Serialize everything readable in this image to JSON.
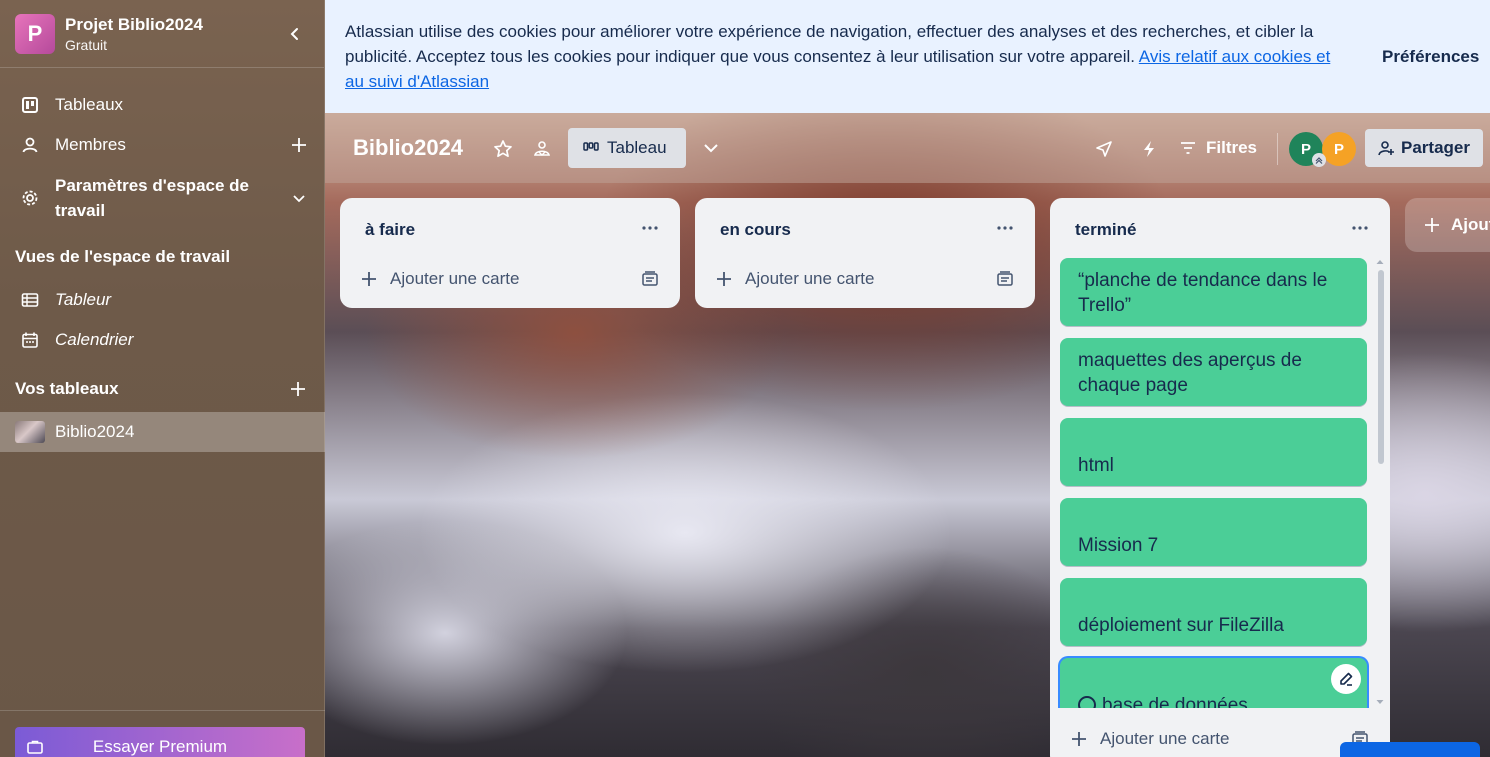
{
  "workspace": {
    "logo_letter": "P",
    "name": "Projet Biblio2024",
    "plan": "Gratuit"
  },
  "sidebar": {
    "items": [
      {
        "label": "Tableaux",
        "icon": "board-icon"
      },
      {
        "label": "Membres",
        "icon": "person-icon"
      },
      {
        "label": "Paramètres d'espace de travail",
        "icon": "gear-icon"
      }
    ],
    "views_title": "Vues de l'espace de travail",
    "views": [
      {
        "label": "Tableur",
        "icon": "table-icon"
      },
      {
        "label": "Calendrier",
        "icon": "calendar-icon"
      }
    ],
    "boards_title": "Vos tableaux",
    "boards": [
      {
        "label": "Biblio2024",
        "active": true
      }
    ],
    "premium_label": "Essayer Premium"
  },
  "cookie_banner": {
    "text": "Atlassian utilise des cookies pour améliorer votre expérience de navigation, effectuer des analyses et des recherches, et cibler la publicité. Acceptez tous les cookies pour indiquer que vous consentez à leur utilisation sur votre appareil. ",
    "link_text": "Avis relatif aux cookies et au suivi d'Atlassian",
    "preferences_label": "Préférences"
  },
  "board_header": {
    "title": "Biblio2024",
    "view_label": "Tableau",
    "filters_label": "Filtres",
    "members": [
      {
        "initial": "P",
        "color": "#1f845a"
      },
      {
        "initial": "P",
        "color": "#f5a225"
      }
    ],
    "share_label": "Partager"
  },
  "lists": [
    {
      "title": "à faire",
      "add_card_label": "Ajouter une carte",
      "cards": []
    },
    {
      "title": "en cours",
      "add_card_label": "Ajouter une carte",
      "cards": []
    },
    {
      "title": "terminé",
      "add_card_label": "Ajouter une carte",
      "cards": [
        {
          "title": "“planche de tendance dans le Trello”"
        },
        {
          "title": "maquettes des aperçus de chaque page"
        },
        {
          "title": "html"
        },
        {
          "title": "Mission 7"
        },
        {
          "title": "déploiement sur FileZilla"
        },
        {
          "title": "base de données"
        }
      ]
    }
  ],
  "add_list_label": "Ajout",
  "colors": {
    "card_green": "#4bce97",
    "list_bg": "#f1f2f4",
    "cookie_bg": "#e9f2ff",
    "link_blue": "#0c66e4"
  }
}
